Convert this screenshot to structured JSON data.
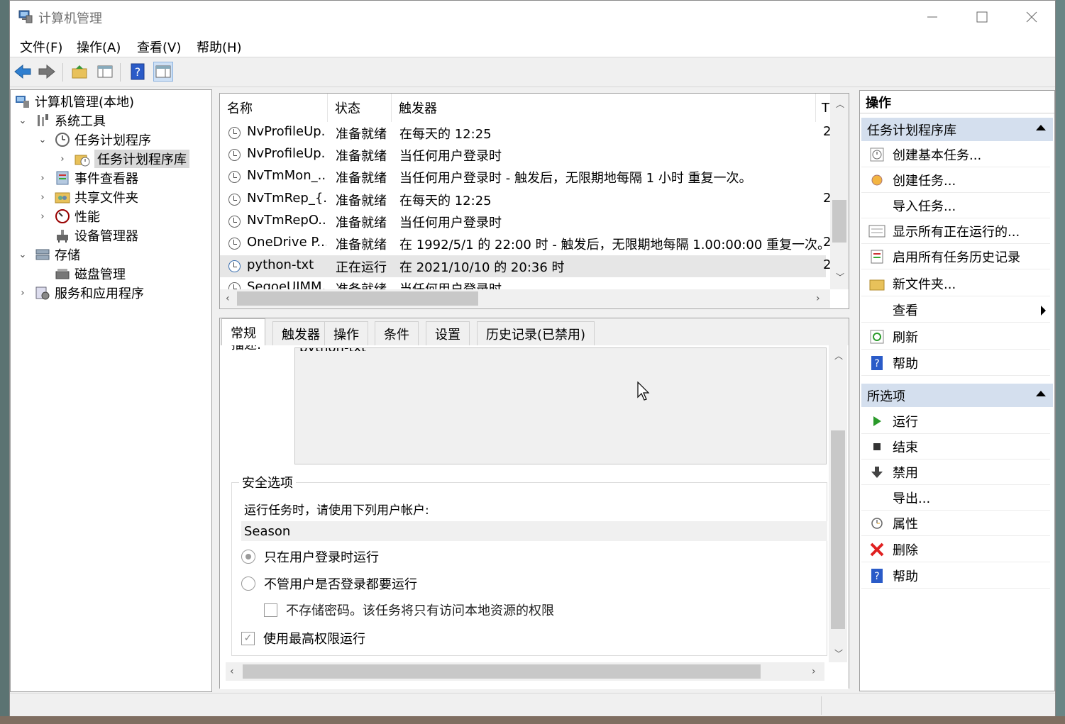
{
  "window": {
    "title": "计算机管理"
  },
  "menu": [
    "文件(F)",
    "操作(A)",
    "查看(V)",
    "帮助(H)"
  ],
  "tree": [
    {
      "label": "计算机管理(本地)",
      "expander": "",
      "level": 0,
      "icon": "computer-icon"
    },
    {
      "label": "系统工具",
      "expander": "⌄",
      "level": 1,
      "icon": "tools-icon"
    },
    {
      "label": "任务计划程序",
      "expander": "⌄",
      "level": 2,
      "icon": "clock-icon"
    },
    {
      "label": "任务计划程序库",
      "expander": "›",
      "level": 3,
      "icon": "folder-clock-icon",
      "selected": true
    },
    {
      "label": "事件查看器",
      "expander": "›",
      "level": 2,
      "icon": "event-viewer-icon"
    },
    {
      "label": "共享文件夹",
      "expander": "›",
      "level": 2,
      "icon": "shared-folder-icon"
    },
    {
      "label": "性能",
      "expander": "›",
      "level": 2,
      "icon": "performance-icon"
    },
    {
      "label": "设备管理器",
      "expander": "",
      "level": 2,
      "icon": "device-manager-icon"
    },
    {
      "label": "存储",
      "expander": "⌄",
      "level": 1,
      "icon": "storage-icon"
    },
    {
      "label": "磁盘管理",
      "expander": "",
      "level": 2,
      "icon": "disk-icon"
    },
    {
      "label": "服务和应用程序",
      "expander": "›",
      "level": 1,
      "icon": "services-icon"
    }
  ],
  "task_list": {
    "columns": [
      "名称",
      "状态",
      "触发器",
      "T"
    ],
    "rows": [
      {
        "name": "NvProfileUp...",
        "status": "准备就绪",
        "trigger": "在每天的 12:25",
        "t": "2"
      },
      {
        "name": "NvProfileUp...",
        "status": "准备就绪",
        "trigger": "当任何用户登录时",
        "t": ""
      },
      {
        "name": "NvTmMon_...",
        "status": "准备就绪",
        "trigger": "当任何用户登录时 - 触发后，无限期地每隔 1 小时 重复一次。",
        "t": ""
      },
      {
        "name": "NvTmRep_{...",
        "status": "准备就绪",
        "trigger": "在每天的 12:25",
        "t": "2"
      },
      {
        "name": "NvTmRepO...",
        "status": "准备就绪",
        "trigger": "当任何用户登录时",
        "t": ""
      },
      {
        "name": "OneDrive P...",
        "status": "准备就绪",
        "trigger": "在 1992/5/1 的 22:00 时 - 触发后，无限期地每隔 1.00:00:00 重复一次。",
        "t": "2"
      },
      {
        "name": "python-txt",
        "status": "正在运行",
        "trigger": "在 2021/10/10 的 20:36 时",
        "t": "2",
        "selected": true
      },
      {
        "name": "SegoeUIMM...",
        "status": "准备就绪",
        "trigger": "当任何用户登录时",
        "t": ""
      }
    ]
  },
  "tabs": [
    "常规",
    "触发器",
    "操作",
    "条件",
    "设置",
    "历史记录(已禁用)"
  ],
  "general": {
    "desc_label": "描述:",
    "desc_value": "python-txt",
    "security_title": "安全选项",
    "run_as_label": "运行任务时，请使用下列用户帐户:",
    "user": "Season",
    "opt_logged_on": "只在用户登录时运行",
    "opt_whether": "不管用户是否登录都要运行",
    "opt_no_password": "不存储密码。该任务将只有访问本地资源的权限",
    "opt_highest": "使用最高权限运行"
  },
  "actions": {
    "header": "操作",
    "section1": "任务计划程序库",
    "items1": [
      {
        "label": "创建基本任务...",
        "icon": "create-basic-task-icon"
      },
      {
        "label": "创建任务...",
        "icon": "create-task-icon"
      },
      {
        "label": "导入任务...",
        "icon": ""
      },
      {
        "label": "显示所有正在运行的...",
        "icon": "running-tasks-icon"
      },
      {
        "label": "启用所有任务历史记录",
        "icon": "history-icon"
      },
      {
        "label": "新文件夹...",
        "icon": "new-folder-icon"
      },
      {
        "label": "查看",
        "icon": "",
        "submenu": true
      },
      {
        "label": "刷新",
        "icon": "refresh-icon"
      },
      {
        "label": "帮助",
        "icon": "help-icon"
      }
    ],
    "section2": "所选项",
    "items2": [
      {
        "label": "运行",
        "icon": "run-icon"
      },
      {
        "label": "结束",
        "icon": "stop-icon"
      },
      {
        "label": "禁用",
        "icon": "disable-icon"
      },
      {
        "label": "导出...",
        "icon": ""
      },
      {
        "label": "属性",
        "icon": "properties-icon"
      },
      {
        "label": "删除",
        "icon": "delete-icon"
      },
      {
        "label": "帮助",
        "icon": "help-icon"
      }
    ]
  }
}
